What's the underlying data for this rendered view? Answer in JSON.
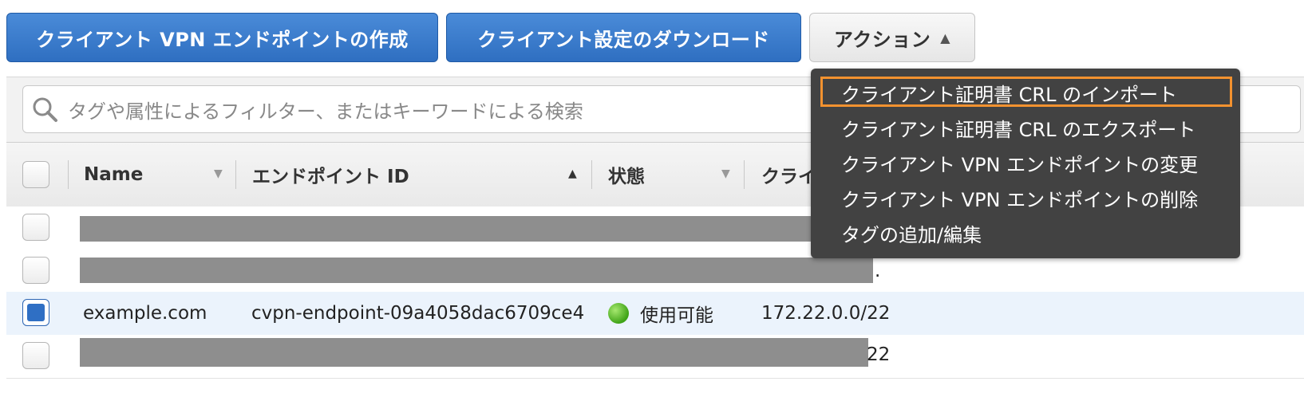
{
  "toolbar": {
    "create_endpoint_label": "クライアント VPN エンドポイントの作成",
    "download_config_label": "クライアント設定のダウンロード",
    "actions_label": "アクション"
  },
  "search": {
    "placeholder": "タグや属性によるフィルター、またはキーワードによる検索"
  },
  "table": {
    "columns": [
      {
        "label": "Name",
        "sort": "unsorted"
      },
      {
        "label": "エンドポイント ID",
        "sort": "ascending"
      },
      {
        "label": "状態",
        "sort": "unsorted"
      },
      {
        "label": "クライ",
        "sort": "none"
      }
    ],
    "rows": [
      {
        "redacted": true,
        "checked": false,
        "tail": ""
      },
      {
        "redacted": true,
        "checked": false,
        "tail": "."
      },
      {
        "redacted": false,
        "checked": true,
        "name": "example.com",
        "endpoint_id": "cvpn-endpoint-09a4058dac6709ce4",
        "status": "使用可能",
        "status_color": "#45a81d",
        "cidr": "172.22.0.0/22"
      },
      {
        "redacted": true,
        "checked": false,
        "tail": "22"
      }
    ]
  },
  "actions_menu": {
    "items": [
      "クライアント証明書 CRL のインポート",
      "クライアント証明書 CRL のエクスポート",
      "クライアント VPN エンドポイントの変更",
      "クライアント VPN エンドポイントの削除",
      "タグの追加/編集"
    ],
    "focused_index": 0
  },
  "colors": {
    "primary_button": "#2f6fc1",
    "menu_background": "#424242",
    "focus_outline": "#f3922f",
    "selected_row": "#ebf3fc"
  }
}
